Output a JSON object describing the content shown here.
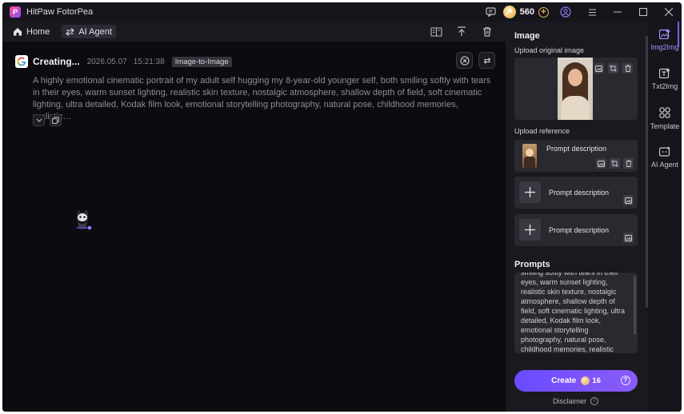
{
  "app": {
    "title": "HitPaw FotorPea",
    "logo_letter": "P"
  },
  "titlebar": {
    "credits": "560"
  },
  "toolbar": {
    "home_label": "Home",
    "agent_label": "AI Agent"
  },
  "task": {
    "status": "Creating...",
    "date": "2026.05.07",
    "time": "15:21:38",
    "tag": "Image-to-Image",
    "prompt": "A highly emotional cinematic portrait of my adult self hugging my 8-year-old younger self, both smiling softly with tears in their eyes, warm sunset lighting, realistic skin texture, nostalgic atmosphere, shallow depth of field, soft cinematic lighting, ultra detailed, Kodak film look, emotional storytelling photography, natural pose, childhood memories, realistic…"
  },
  "panel": {
    "image_title": "Image",
    "upload_original_label": "Upload original image",
    "upload_reference_label": "Upload reference",
    "reference_cards": [
      {
        "label": "Prompt description"
      },
      {
        "label": "Prompt description"
      },
      {
        "label": "Prompt description"
      }
    ],
    "prompts_title": "Prompts",
    "prompts_text": "smiling softly with tears in their eyes, warm sunset lighting, realistic skin texture, nostalgic atmosphere, shallow depth of field, soft cinematic lighting, ultra detailed, Kodak film look, emotional storytelling photography, natural pose, childhood memories, realistic facial expressions",
    "create_label": "Create",
    "create_cost": "16",
    "disclaimer": "Disclaimer"
  },
  "sidebar": {
    "items": [
      {
        "label": "Img2Img"
      },
      {
        "label": "Txt2Img"
      },
      {
        "label": "Template"
      },
      {
        "label": "AI Agent"
      }
    ]
  },
  "colors": {
    "accent": "#7b5cff",
    "background": "#0c0b10",
    "panel": "#1a1920"
  }
}
